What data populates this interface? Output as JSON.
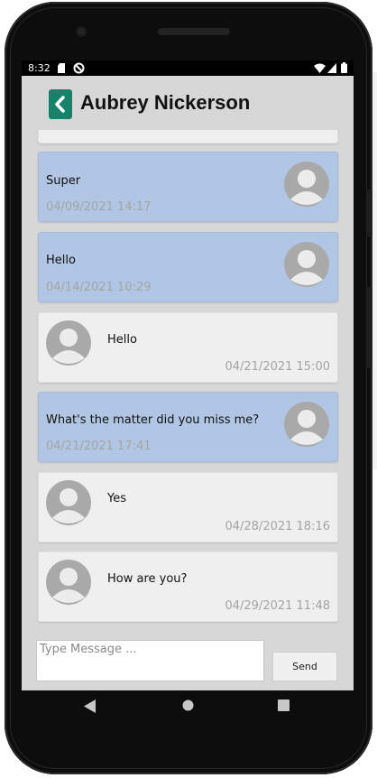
{
  "status_bar": {
    "time": "8:32",
    "icons": [
      "sd-card-icon",
      "no-sync-icon",
      "wifi-icon",
      "signal-icon",
      "battery-icon"
    ]
  },
  "header": {
    "title": "Aubrey Nickerson",
    "back_icon": "chevron-left-icon",
    "accent_color": "#17826a"
  },
  "messages": [
    {
      "type": "sent",
      "text": "Super",
      "time": "04/09/2021 14:17"
    },
    {
      "type": "sent",
      "text": "Hello",
      "time": "04/14/2021 10:29"
    },
    {
      "type": "received",
      "text": "Hello",
      "time": "04/21/2021 15:00"
    },
    {
      "type": "sent",
      "text": "What's the matter did you miss me?",
      "time": "04/21/2021 17:41"
    },
    {
      "type": "received",
      "text": "Yes",
      "time": "04/28/2021 18:16"
    },
    {
      "type": "received",
      "text": "How are you?",
      "time": "04/29/2021 11:48"
    }
  ],
  "composer": {
    "placeholder": "Type Message ...",
    "value": "",
    "send_label": "Send"
  },
  "colors": {
    "sent_bubble": "#b1c6e4",
    "received_bubble": "#efefef",
    "screen_background": "#d7d7d7"
  }
}
